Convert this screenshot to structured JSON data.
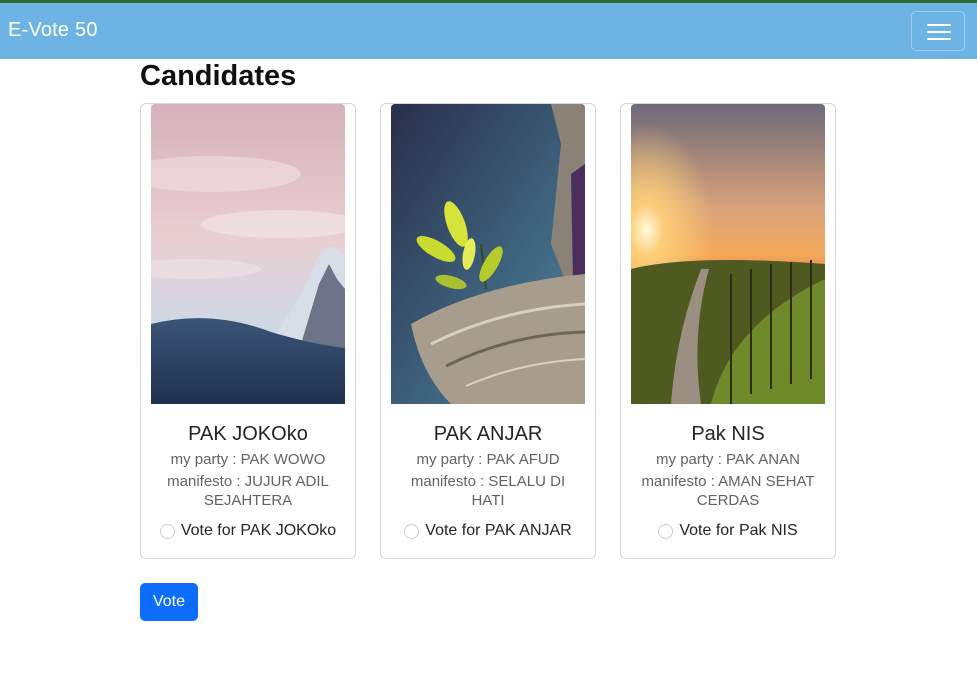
{
  "navbar": {
    "brand": "E-Vote 50",
    "toggle_icon": "hamburger-menu-icon",
    "colors": {
      "background": "#6db4e4",
      "topline": "#2d6a2b"
    }
  },
  "page": {
    "title": "Candidates"
  },
  "candidates": [
    {
      "name": "PAK JOKOko",
      "party": "my party : PAK WOWO",
      "manifesto": "manifesto : JUJUR ADIL SEJAHTERA",
      "vote_label": "Vote for PAK JOKOko",
      "selected": false,
      "image": "snowy-mountain-pink-sky-photo"
    },
    {
      "name": "PAK ANJAR",
      "party": "my party : PAK AFUD",
      "manifesto": "manifesto : SELALU DI HATI",
      "vote_label": "Vote for PAK ANJAR",
      "selected": false,
      "image": "plant-on-rock-photo"
    },
    {
      "name": "Pak NIS",
      "party": "my party : PAK ANAN",
      "manifesto": "manifesto : AMAN SEHAT CERDAS",
      "vote_label": "Vote for Pak NIS",
      "selected": false,
      "image": "sunset-vineyard-photo"
    }
  ],
  "submit": {
    "label": "Vote",
    "color": "#0d6efd"
  }
}
